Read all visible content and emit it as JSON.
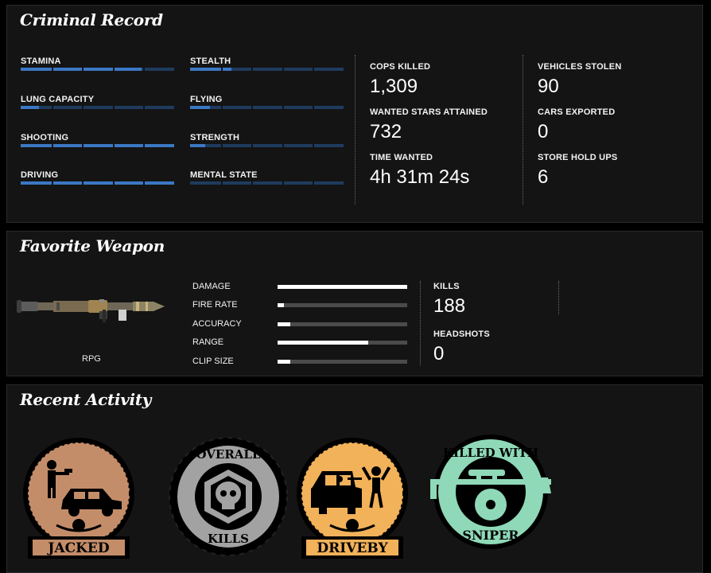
{
  "criminal_record": {
    "title": "Criminal Record",
    "skills": [
      {
        "label": "STAMINA",
        "level": 0.79
      },
      {
        "label": "STEALTH",
        "level": 0.27
      },
      {
        "label": "LUNG CAPACITY",
        "level": 0.12
      },
      {
        "label": "FLYING",
        "level": 0.13
      },
      {
        "label": "SHOOTING",
        "level": 1.0
      },
      {
        "label": "STRENGTH",
        "level": 0.1
      },
      {
        "label": "DRIVING",
        "level": 1.0
      },
      {
        "label": "MENTAL STATE",
        "level": 0.0
      }
    ],
    "stats_left": [
      {
        "label": "COPS KILLED",
        "value": "1,309"
      },
      {
        "label": "WANTED STARS ATTAINED",
        "value": "732"
      },
      {
        "label": "TIME WANTED",
        "value": "4h 31m 24s"
      }
    ],
    "stats_right": [
      {
        "label": "VEHICLES STOLEN",
        "value": "90"
      },
      {
        "label": "CARS EXPORTED",
        "value": "0"
      },
      {
        "label": "STORE HOLD UPS",
        "value": "6"
      }
    ]
  },
  "favorite_weapon": {
    "title": "Favorite Weapon",
    "name": "RPG",
    "stats": [
      {
        "label": "DAMAGE",
        "level": 1.0
      },
      {
        "label": "FIRE RATE",
        "level": 0.05
      },
      {
        "label": "ACCURACY",
        "level": 0.1
      },
      {
        "label": "RANGE",
        "level": 0.7
      },
      {
        "label": "CLIP SIZE",
        "level": 0.1
      }
    ],
    "kills_label": "KILLS",
    "kills_value": "188",
    "headshots_label": "HEADSHOTS",
    "headshots_value": "0"
  },
  "recent_activity": {
    "title": "Recent Activity",
    "badges": [
      {
        "label": "JACKED",
        "color": "#c48d69"
      },
      {
        "top": "OVERALL",
        "bottom": "KILLS",
        "color": "#a2a2a2"
      },
      {
        "label": "DRIVEBY",
        "color": "#f2b25a"
      },
      {
        "top": "KILLED WITH",
        "bottom": "SNIPER",
        "color": "#8fd9b8"
      }
    ]
  },
  "colors": {
    "panel_bg": "#141414",
    "bar_fill": "#3b78c4",
    "bar_track": "#1f3b5e"
  }
}
